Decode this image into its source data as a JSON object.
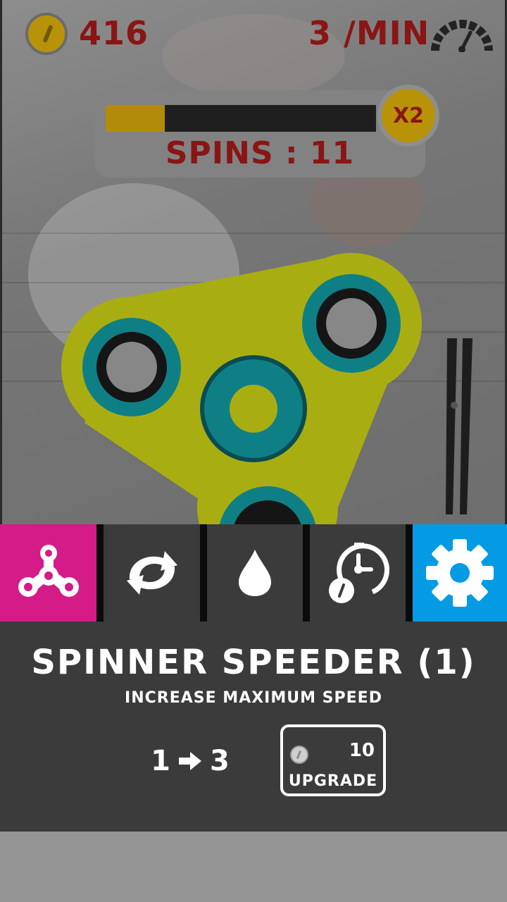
{
  "hud": {
    "coins": "416",
    "rate": "3 /MIN",
    "coin_icon": "coin-icon",
    "gauge_icon": "speedometer-icon"
  },
  "spins": {
    "label": "SPINS : 11",
    "multiplier": "X2",
    "progress_fraction": 0.22
  },
  "colors": {
    "hud_text": "#8a1515",
    "progress_fill": "#b28b0a",
    "spinner_body": "#a8ae11",
    "spinner_ring": "#0f7f86",
    "tab_spinner": "#d41b87",
    "tab_settings": "#049be4",
    "tab_default": "#3b3b3b"
  },
  "tabs": [
    {
      "name": "spinner-tab",
      "icon": "fidget-spinner-icon",
      "active": true
    },
    {
      "name": "refresh-tab",
      "icon": "refresh-icon",
      "active": false
    },
    {
      "name": "drop-tab",
      "icon": "water-drop-icon",
      "active": false
    },
    {
      "name": "timer-tab",
      "icon": "timer-coin-icon",
      "active": false
    },
    {
      "name": "settings-tab",
      "icon": "gear-icon",
      "active": false
    }
  ],
  "upgrade": {
    "title": "SPINNER SPEEDER (1)",
    "subtitle": "INCREASE MAXIMUM SPEED",
    "from_level": "1",
    "to_level": "3",
    "price": "10",
    "button_label": "UPGRADE"
  }
}
